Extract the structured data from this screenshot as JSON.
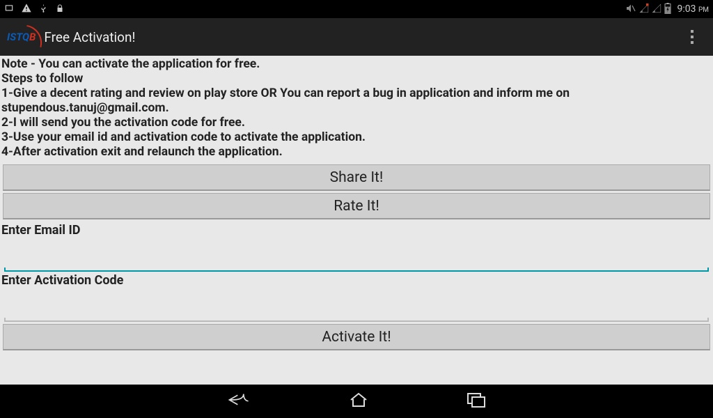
{
  "status": {
    "time": "9:03",
    "ampm": "PM"
  },
  "appbar": {
    "title": "Free Activation!"
  },
  "note": {
    "line0": "Note - You can activate the application for free.",
    "line1": "Steps to follow",
    "line2": "1-Give a decent rating and review on play store OR You can report a bug in application and inform me on stupendous.tanuj@gmail.com.",
    "line3": "2-I will send you the activation code for free.",
    "line4": "3-Use your email id and activation code to activate the application.",
    "line5": "4-After activation exit and relaunch the application."
  },
  "buttons": {
    "share": "Share It!",
    "rate": "Rate It!",
    "activate": "Activate It!"
  },
  "labels": {
    "email": "Enter Email ID",
    "code": "Enter Activation Code"
  }
}
